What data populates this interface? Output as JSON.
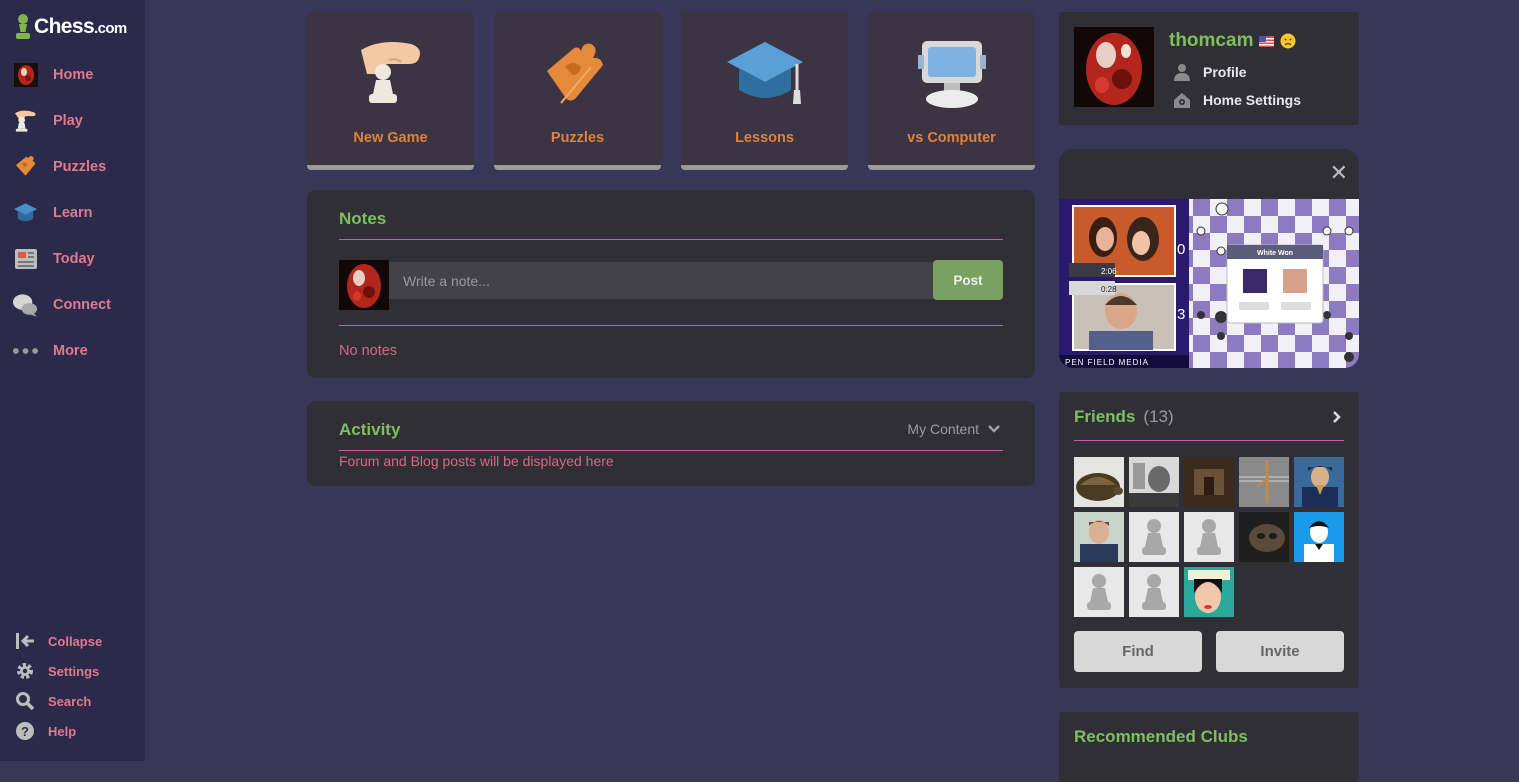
{
  "sidebar": {
    "logo": {
      "main": "Chess",
      "suffix": ".com"
    },
    "items": [
      {
        "label": "Home",
        "icon": "home-avatar-icon"
      },
      {
        "label": "Play",
        "icon": "play-hand-icon"
      },
      {
        "label": "Puzzles",
        "icon": "puzzle-icon"
      },
      {
        "label": "Learn",
        "icon": "graduation-cap-icon"
      },
      {
        "label": "Today",
        "icon": "newspaper-icon"
      },
      {
        "label": "Connect",
        "icon": "chat-bubbles-icon"
      },
      {
        "label": "More",
        "icon": "dots-icon"
      }
    ],
    "bottom": [
      {
        "label": "Collapse",
        "icon": "collapse-icon"
      },
      {
        "label": "Settings",
        "icon": "gear-icon"
      },
      {
        "label": "Search",
        "icon": "search-icon"
      },
      {
        "label": "Help",
        "icon": "help-icon"
      }
    ]
  },
  "tiles": [
    {
      "label": "New Game",
      "icon": "pawn-hand-icon"
    },
    {
      "label": "Puzzles",
      "icon": "puzzle-piece-icon"
    },
    {
      "label": "Lessons",
      "icon": "mortarboard-icon"
    },
    {
      "label": "vs Computer",
      "icon": "computer-icon"
    }
  ],
  "notes": {
    "title": "Notes",
    "placeholder": "Write a note...",
    "post_label": "Post",
    "empty": "No notes"
  },
  "activity": {
    "title": "Activity",
    "filter_label": "My Content",
    "empty": "Forum and Blog posts will be displayed here"
  },
  "profile": {
    "username": "thomcam",
    "links": [
      {
        "label": "Profile",
        "icon": "person-icon"
      },
      {
        "label": "Home Settings",
        "icon": "home-gear-icon"
      }
    ]
  },
  "video": {
    "score_top": "0",
    "score_bottom": "3",
    "clock_top": "2:06",
    "clock_bottom": "0:28",
    "popup_title": "White Won",
    "footer_brand": "PEN FIELD MEDIA"
  },
  "friends": {
    "title": "Friends",
    "count": "(13)",
    "find_label": "Find",
    "invite_label": "Invite"
  },
  "clubs": {
    "title": "Recommended Clubs"
  },
  "colors": {
    "accent_green": "#7fbf5f",
    "accent_orange": "#e0823a",
    "accent_pink": "#e07a8e",
    "rule_magenta": "#c65ab0"
  }
}
